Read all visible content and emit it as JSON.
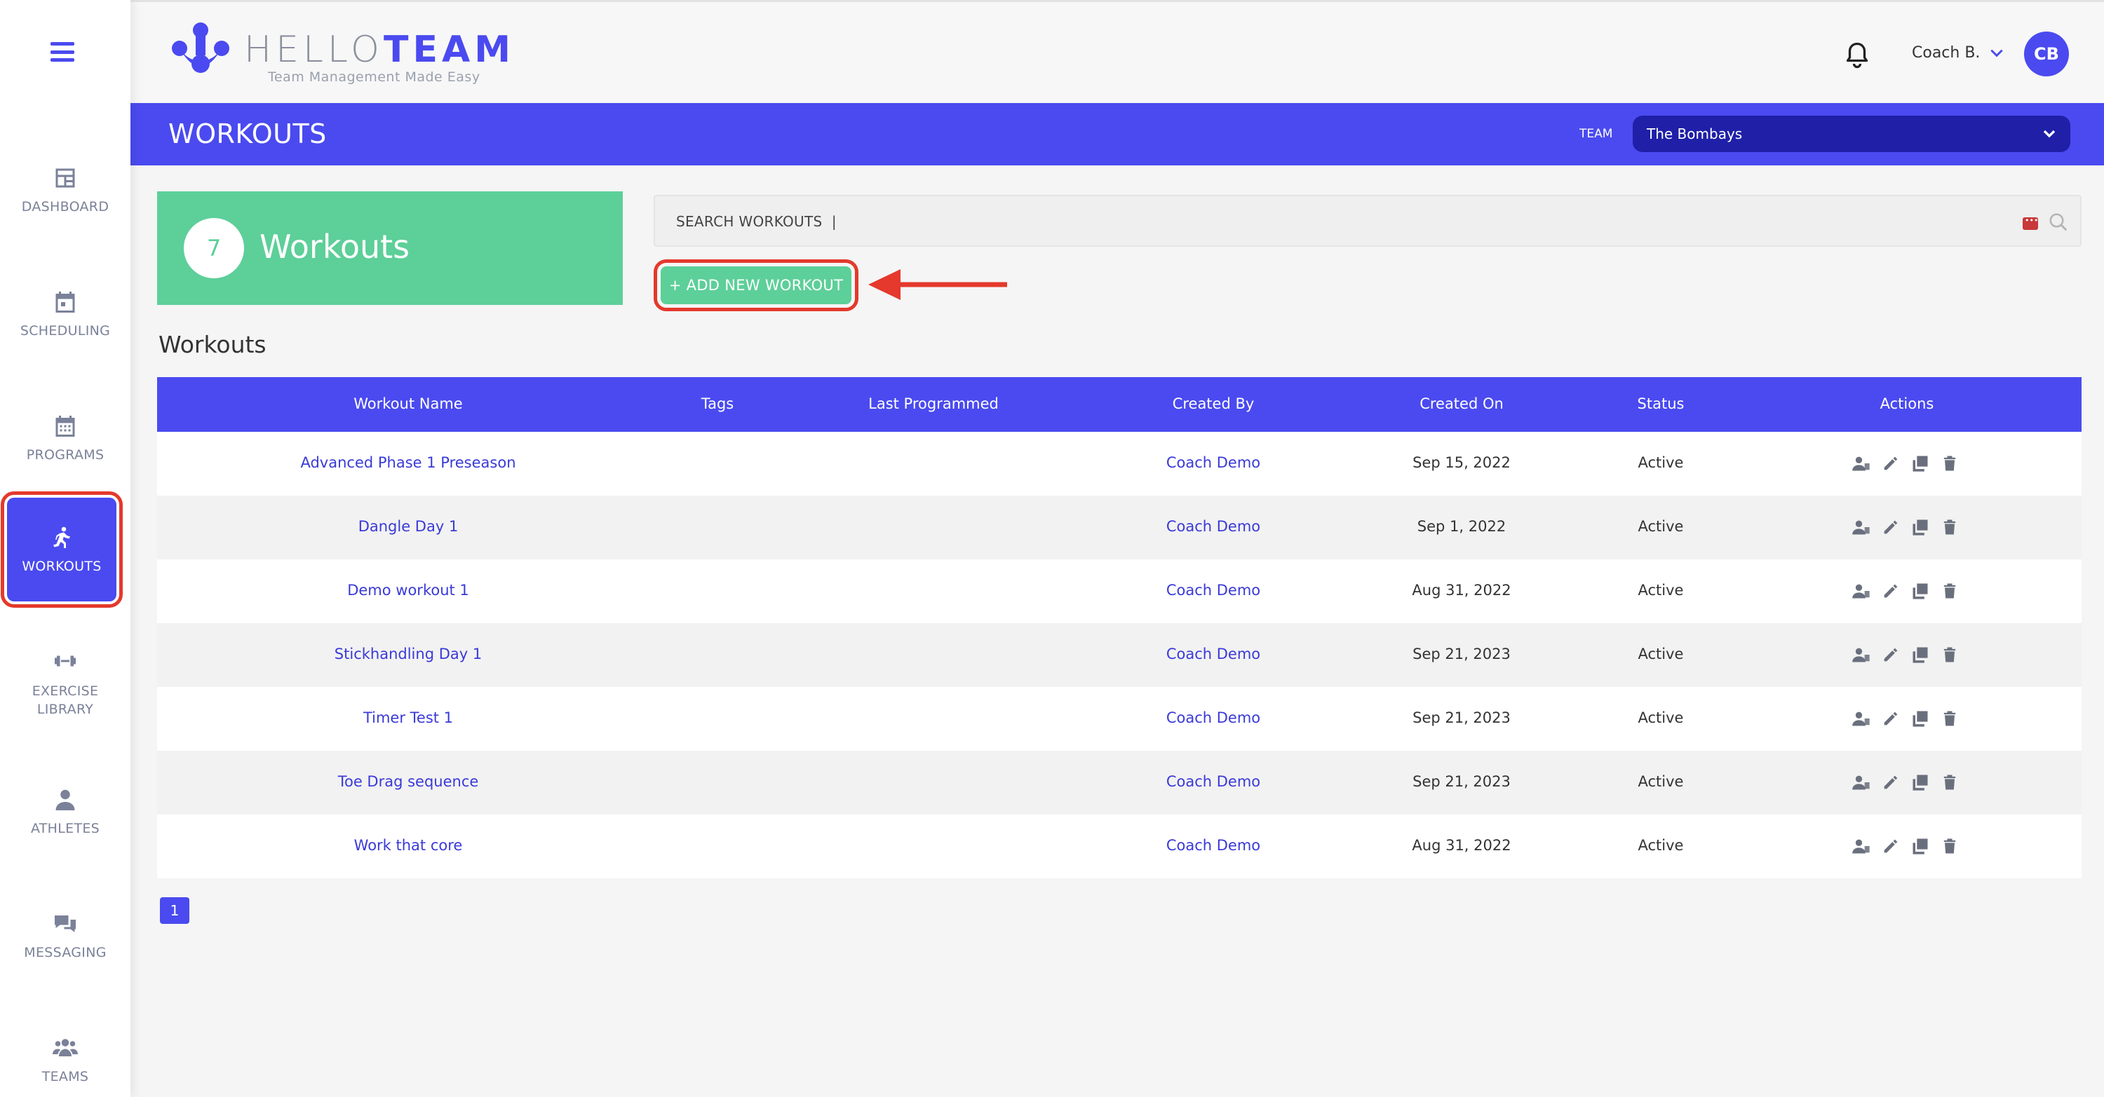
{
  "app": {
    "brand_hello": "HELLO",
    "brand_team": "TEAM",
    "tagline": "Team Management Made Easy"
  },
  "user": {
    "name": "Coach B.",
    "initials": "CB"
  },
  "sidebar": {
    "items": [
      {
        "label": "DASHBOARD",
        "icon": "dashboard-icon"
      },
      {
        "label": "SCHEDULING",
        "icon": "calendar-icon"
      },
      {
        "label": "PROGRAMS",
        "icon": "calendar-grid-icon"
      },
      {
        "label": "WORKOUTS",
        "icon": "running-icon",
        "active": true
      },
      {
        "label": "EXERCISE LIBRARY",
        "icon": "dumbbell-icon"
      },
      {
        "label": "ATHLETES",
        "icon": "person-icon"
      },
      {
        "label": "MESSAGING",
        "icon": "chat-icon"
      },
      {
        "label": "TEAMS",
        "icon": "group-icon"
      }
    ]
  },
  "titlebar": {
    "title": "WORKOUTS",
    "team_label": "TEAM",
    "team_selected": "The Bombays"
  },
  "summary": {
    "count": "7",
    "label": "Workouts"
  },
  "search": {
    "placeholder": "SEARCH WORKOUTS  |"
  },
  "add_button": {
    "label": "+ ADD NEW WORKOUT"
  },
  "section_title": "Workouts",
  "table": {
    "headers": [
      "Workout Name",
      "Tags",
      "Last Programmed",
      "Created By",
      "Created On",
      "Status",
      "Actions"
    ],
    "rows": [
      {
        "name": "Advanced Phase 1 Preseason",
        "tags": "",
        "last": "",
        "by": "Coach Demo",
        "on": "Sep 15, 2022",
        "status": "Active"
      },
      {
        "name": "Dangle Day 1",
        "tags": "",
        "last": "",
        "by": "Coach Demo",
        "on": "Sep 1, 2022",
        "status": "Active"
      },
      {
        "name": "Demo workout 1",
        "tags": "",
        "last": "",
        "by": "Coach Demo",
        "on": "Aug 31, 2022",
        "status": "Active"
      },
      {
        "name": "Stickhandling Day 1",
        "tags": "",
        "last": "",
        "by": "Coach Demo",
        "on": "Sep 21, 2023",
        "status": "Active"
      },
      {
        "name": "Timer Test 1",
        "tags": "",
        "last": "",
        "by": "Coach Demo",
        "on": "Sep 21, 2023",
        "status": "Active"
      },
      {
        "name": "Toe Drag sequence",
        "tags": "",
        "last": "",
        "by": "Coach Demo",
        "on": "Sep 21, 2023",
        "status": "Active"
      },
      {
        "name": "Work that core",
        "tags": "",
        "last": "",
        "by": "Coach Demo",
        "on": "Aug 31, 2022",
        "status": "Active"
      }
    ]
  },
  "pagination": {
    "current": "1"
  },
  "colors": {
    "primary": "#4a4af0",
    "success": "#5dcf99",
    "highlight": "#e4392c"
  }
}
